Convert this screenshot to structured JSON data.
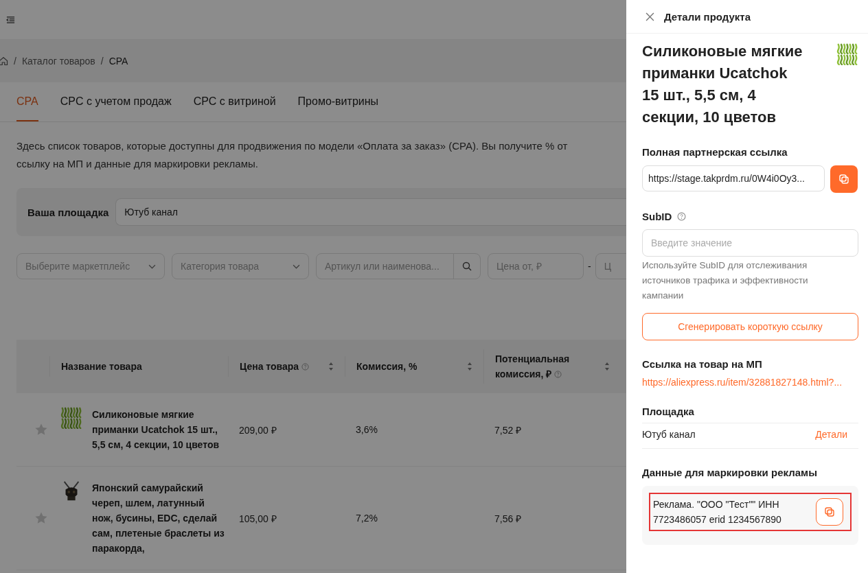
{
  "breadcrumbs": [
    {
      "separator": "/",
      "label": "Каталог товаров"
    },
    {
      "separator": "/",
      "label": "CPA"
    }
  ],
  "tabs": [
    {
      "label": "CPA",
      "selected": true
    },
    {
      "label": "CPC с учетом продаж",
      "selected": false
    },
    {
      "label": "CPC с витриной",
      "selected": false
    },
    {
      "label": "Промо-витрины",
      "selected": false
    }
  ],
  "description_lines": [
    "Здесь список товаров, которые доступны для продвижения по модели «Оплата за заказ» (CPA). Вы получите % от",
    "ссылку на МП и данные для маркировки рекламы."
  ],
  "platform": {
    "label": "Ваша площадка",
    "value": "Ютуб канал"
  },
  "filters": [
    {
      "kind": "select",
      "placeholder": "Выберите маркетплейс"
    },
    {
      "kind": "select",
      "placeholder": "Категория товара"
    },
    {
      "kind": "search",
      "placeholder": "Артикул или наименова..."
    },
    {
      "kind": "text",
      "placeholder": "Цена от, ₽"
    },
    {
      "kind": "dash",
      "text": "-"
    },
    {
      "kind": "text",
      "placeholder": "Ц"
    }
  ],
  "table": {
    "columns": [
      {
        "label": "Название товара",
        "help": false,
        "sortable": false
      },
      {
        "label": "Цена товара",
        "help": true,
        "sortable": true
      },
      {
        "label": "Комиссия, %",
        "help": false,
        "sortable": true
      },
      {
        "label": "Потенциальная комиссия, ₽",
        "help": true,
        "sortable": true
      }
    ],
    "rows": [
      {
        "favorite": false,
        "kind": "lures",
        "name": "Силиконовые мягкие приманки Ucatchok 15 шт., 5,5 см, 4 секции, 10 цветов",
        "price": "209,00 ₽",
        "commission": "3,6%",
        "potential": "7,52 ₽"
      },
      {
        "favorite": false,
        "kind": "helmet",
        "name": "Японский самурайский череп, шлем, латунный нож, бусины, EDC, сделай сам, плетеные браслеты из паракорда,",
        "price": "105,00 ₽",
        "commission": "7,2%",
        "potential": "7,56 ₽"
      }
    ]
  },
  "drawer": {
    "title": "Детали продукта",
    "product_title": "Силиконовые мягкие приманки Ucatchok 15 шт., 5,5 см, 4 секции, 10 цветов",
    "affiliate_label": "Полная партнерская ссылка",
    "affiliate_value": "https://stage.takprdm.ru/0W4i0Oy3...",
    "subid_label": "SubID",
    "subid_placeholder": "Введите значение",
    "subid_help": "Используйте SubID для отслеживания источников трафика и эффективности кампании",
    "generate_button": "Сгенерировать короткую ссылку",
    "mp_label": "Ссылка на товар на МП",
    "mp_link": "https://aliexpress.ru/item/32881827148.html?...",
    "platform_label": "Площадка",
    "platform_value": "Ютуб канал",
    "platform_link": "Детали",
    "ad_label": "Данные для маркировки рекламы",
    "ad_text": "Реклама. \"ООО \"Тест\"\" ИНН 7723486057 erid 1234567890",
    "ad_highlighted": true
  }
}
